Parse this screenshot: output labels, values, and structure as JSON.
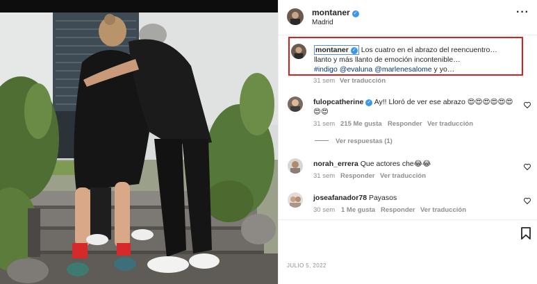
{
  "post": {
    "username": "montaner",
    "location": "Madrid",
    "more_icon": "more-horizontal-icon"
  },
  "caption": {
    "username": "montaner",
    "text_line1": "Los cuatro en el abrazo del reencuentro…",
    "text_line2": "llanto y más llanto de emoción incontenible…",
    "hashtag": "#indigo",
    "mention1": "@evaluna",
    "mention2": "@marlenesalome",
    "tail": "y yo…",
    "time": "31 sem",
    "translate": "Ver traducción"
  },
  "comments": [
    {
      "username": "fulopcatherine",
      "verified": true,
      "text": "Ay!! Lloró de ver ese abrazo 😍😍😍😍😍😍",
      "text_line2": "😍😍",
      "time": "31 sem",
      "likes": "215 Me gusta",
      "reply": "Responder",
      "translate": "Ver traducción",
      "view_replies": "Ver respuestas (1)"
    },
    {
      "username": "norah_errera",
      "text": "Que actores che😂😂",
      "time": "31 sem",
      "reply": "Responder",
      "translate": "Ver traducción"
    },
    {
      "username": "joseafanador78",
      "text": "Payasos",
      "time": "30 sem",
      "likes": "1 Me gusta",
      "reply": "Responder",
      "translate": "Ver traducción"
    }
  ],
  "date": "JULIO 5, 2022",
  "icons": {
    "verified": "verified-badge-icon",
    "heart": "heart-outline-icon",
    "bookmark": "bookmark-outline-icon"
  },
  "colors": {
    "verified": "#3897f0",
    "highlight_box": "#d62020",
    "muted_text": "#8e8e8e",
    "link": "#00376b"
  }
}
